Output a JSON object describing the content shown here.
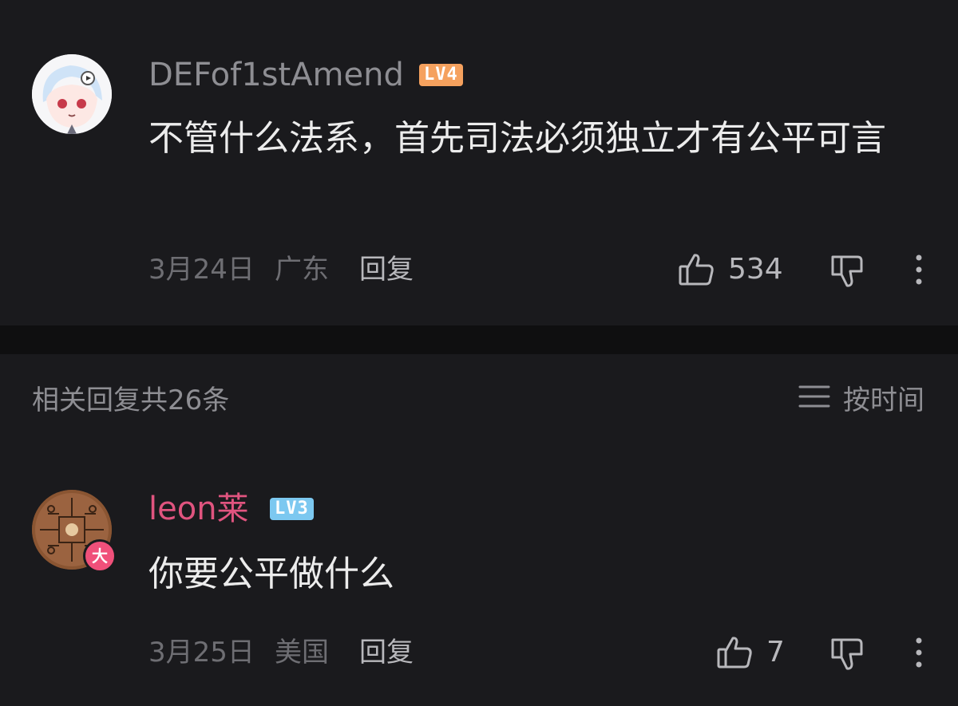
{
  "comment": {
    "username": "DEFof1stAmend",
    "level": "LV4",
    "text": "不管什么法系，首先司法必须独立才有公平可言",
    "date": "3月24日",
    "location": "广东",
    "reply_label": "回复",
    "like_count": "534",
    "username_color": "#8e8e93",
    "level_color": "#f5a15e"
  },
  "replies_header": {
    "title": "相关回复共26条",
    "sort_label": "按时间"
  },
  "reply": {
    "username": "leon莱",
    "level": "LV3",
    "badge": "大",
    "text": "你要公平做什么",
    "date": "3月25日",
    "location": "美国",
    "reply_label": "回复",
    "like_count": "7",
    "username_color": "#e0547f",
    "level_color": "#7cc8f0"
  }
}
